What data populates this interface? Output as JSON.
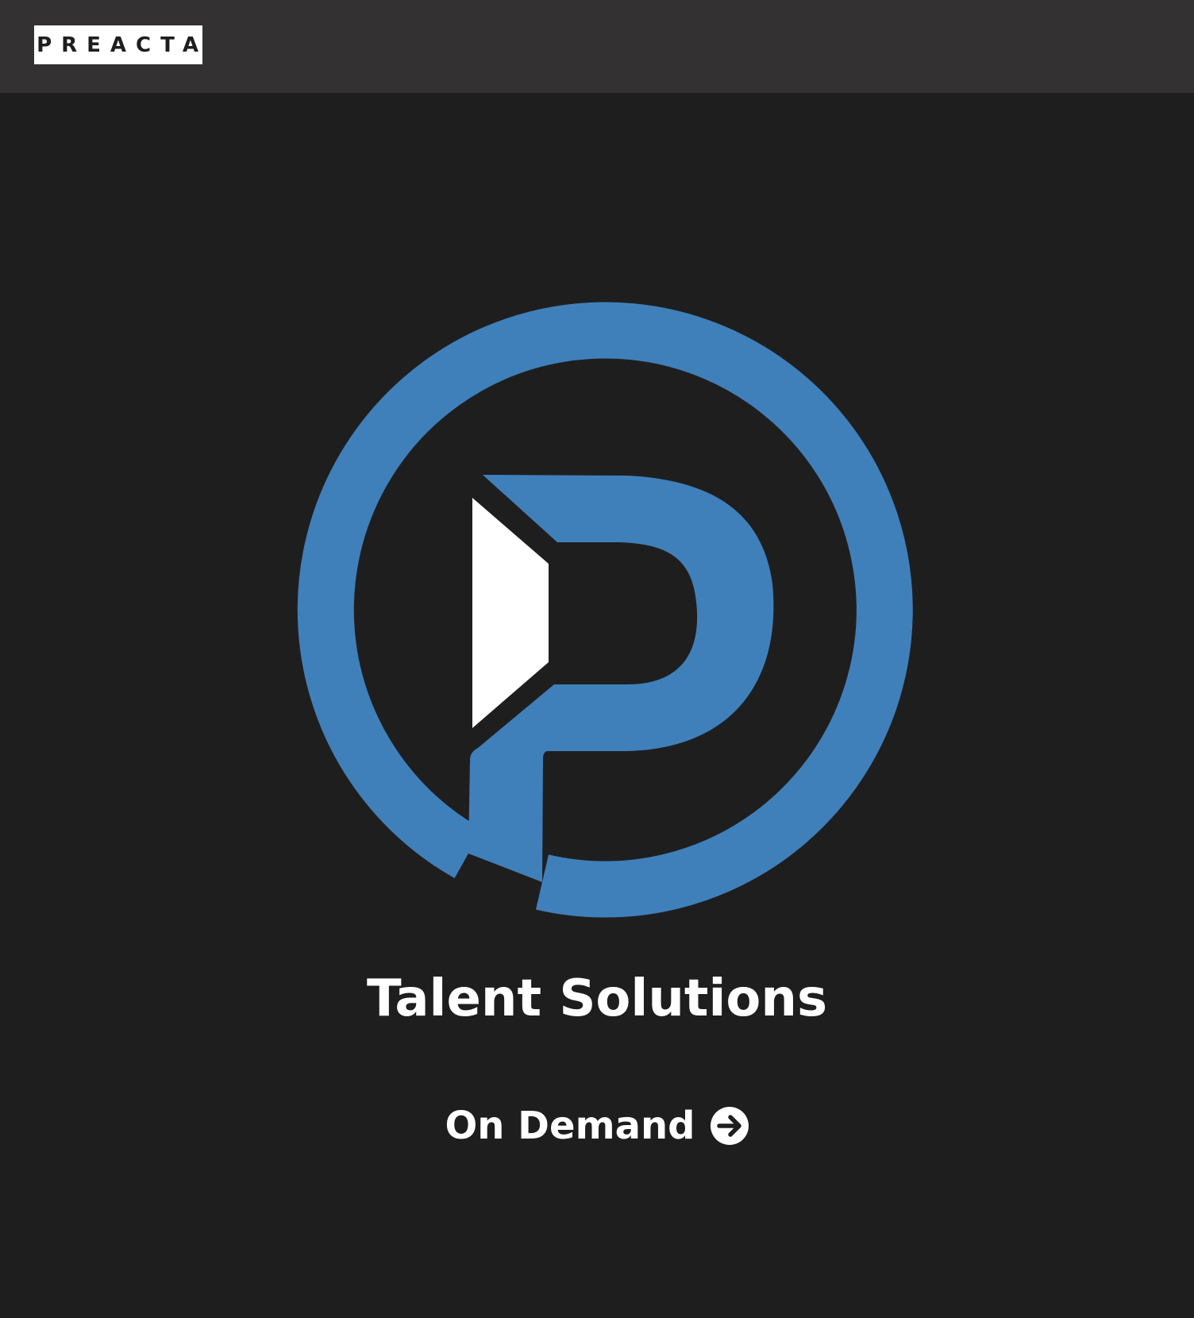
{
  "header": {
    "brand_label": "PREACTA"
  },
  "hero": {
    "logo_icon": "preacta-p-circle-logo",
    "title": "Talent Solutions",
    "cta_label": "On Demand",
    "cta_icon": "arrow-right-circle-icon"
  },
  "colors": {
    "background": "#1f1e1f",
    "header_background": "#333132",
    "accent_blue": "#3f80ba",
    "text": "#ffffff"
  }
}
